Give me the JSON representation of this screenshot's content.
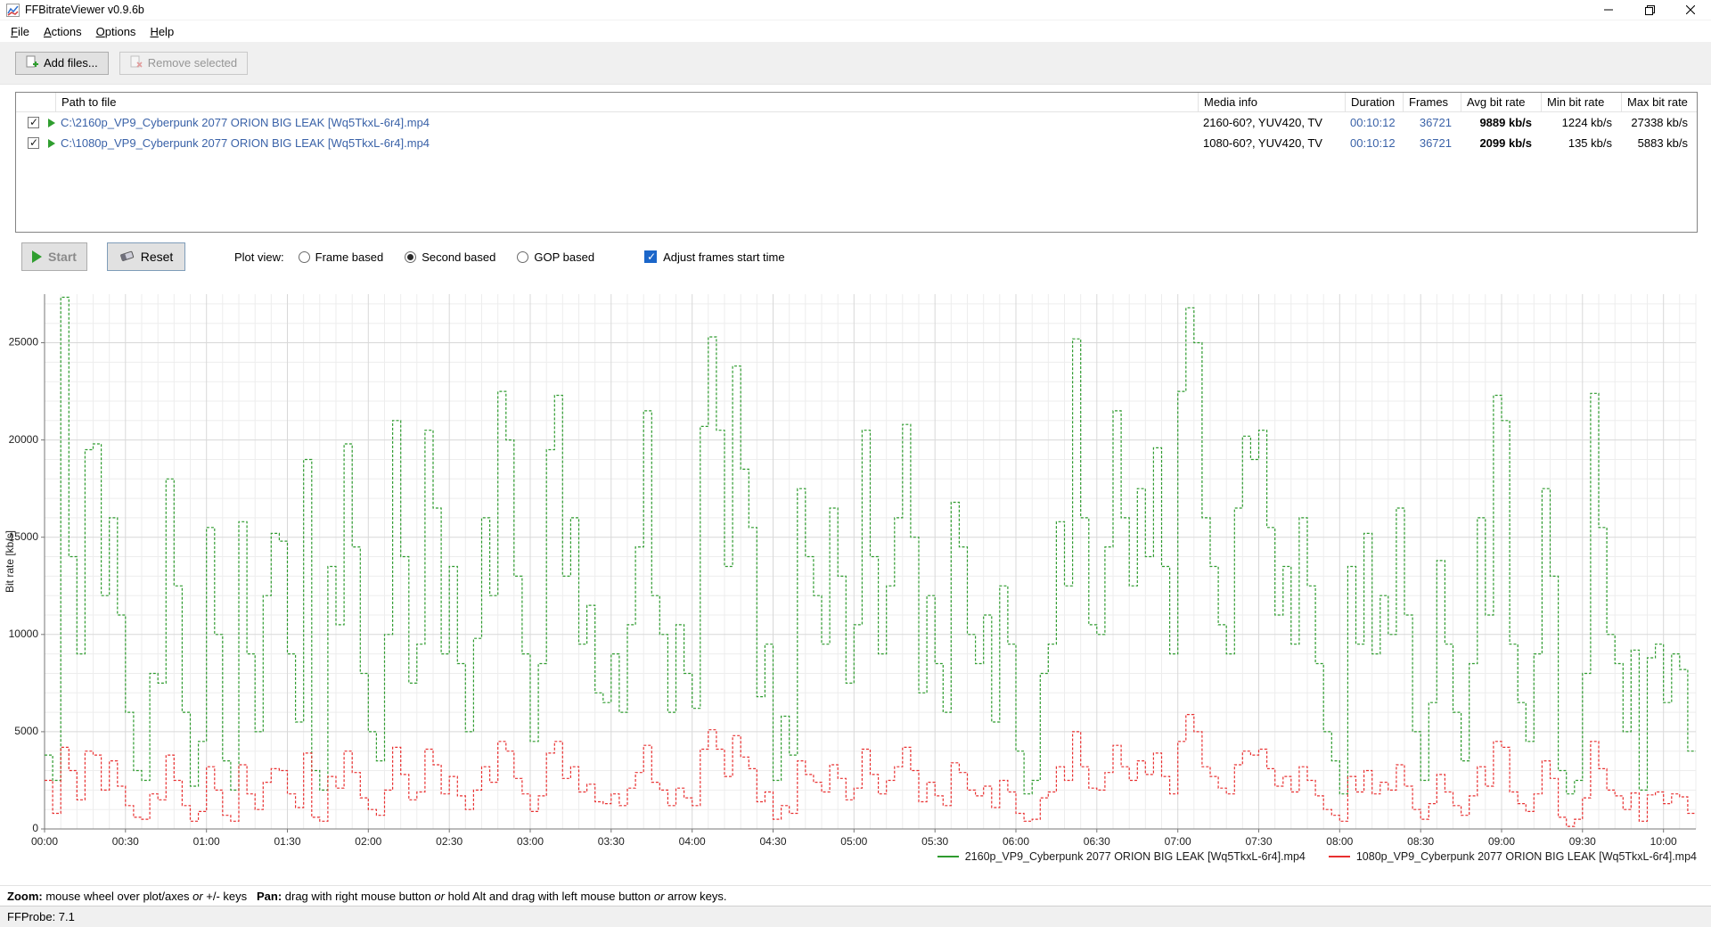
{
  "window": {
    "title": "FFBitrateViewer v0.9.6b"
  },
  "menu": {
    "items": [
      {
        "label": "File"
      },
      {
        "label": "Actions"
      },
      {
        "label": "Options"
      },
      {
        "label": "Help"
      }
    ]
  },
  "toolbar": {
    "add_files": "Add files...",
    "remove_selected": "Remove selected"
  },
  "table": {
    "headers": {
      "path": "Path to file",
      "media": "Media info",
      "duration": "Duration",
      "frames": "Frames",
      "avg": "Avg bit rate",
      "min": "Min bit rate",
      "max": "Max bit rate"
    },
    "rows": [
      {
        "checked": true,
        "path": "C:\\2160p_VP9_Cyberpunk 2077 ORION BIG LEAK [Wq5TkxL-6r4].mp4",
        "media": "2160-60?, YUV420, TV",
        "duration": "00:10:12",
        "frames": "36721",
        "avg": "9889 kb/s",
        "min": "1224 kb/s",
        "max": "27338 kb/s"
      },
      {
        "checked": true,
        "path": "C:\\1080p_VP9_Cyberpunk 2077 ORION BIG LEAK [Wq5TkxL-6r4].mp4",
        "media": "1080-60?, YUV420, TV",
        "duration": "00:10:12",
        "frames": "36721",
        "avg": "2099 kb/s",
        "min": "135 kb/s",
        "max": "5883 kb/s"
      }
    ]
  },
  "controls": {
    "start": "Start",
    "reset": "Reset",
    "plot_view_label": "Plot view:",
    "radios": [
      {
        "label": "Frame based",
        "selected": false
      },
      {
        "label": "Second based",
        "selected": true
      },
      {
        "label": "GOP based",
        "selected": false
      }
    ],
    "adjust_checkbox": {
      "label": "Adjust frames start time",
      "checked": true
    }
  },
  "chart_data": {
    "type": "line",
    "style": "dashed-step",
    "title": "",
    "xlabel": "",
    "ylabel": "Bit rate [kb/s]",
    "ylim": [
      0,
      27500
    ],
    "xlim_seconds": [
      0,
      612
    ],
    "x_step_seconds": 3,
    "yticks": [
      0,
      5000,
      10000,
      15000,
      20000,
      25000
    ],
    "xtick_interval_seconds": 30,
    "xtick_labels": [
      "00:00",
      "00:30",
      "01:00",
      "01:30",
      "02:00",
      "02:30",
      "03:00",
      "03:30",
      "04:00",
      "04:30",
      "05:00",
      "05:30",
      "06:00",
      "06:30",
      "07:00",
      "07:30",
      "08:00",
      "08:30",
      "09:00",
      "09:30",
      "10:00"
    ],
    "grid": true,
    "legend_position": "bottom-right",
    "series": [
      {
        "name": "2160p_VP9_Cyberpunk 2077 ORION BIG LEAK [Wq5TkxL-6r4].mp4",
        "color": "#2e9b2e",
        "avg_kbps": 9889,
        "min_kbps": 1224,
        "max_kbps": 27338,
        "values": [
          3800,
          2500,
          27338,
          14000,
          9000,
          19500,
          19800,
          12000,
          16000,
          11000,
          6000,
          3000,
          2500,
          8000,
          7500,
          18000,
          12500,
          6000,
          2200,
          4500,
          15500,
          10000,
          3500,
          2000,
          15800,
          9000,
          5000,
          12000,
          15200,
          14800,
          9000,
          5500,
          19000,
          3000,
          2000,
          13500,
          10500,
          19800,
          14500,
          8000,
          5000,
          3500,
          10000,
          21000,
          14000,
          7500,
          9500,
          20500,
          16500,
          9000,
          13500,
          8500,
          5000,
          9800,
          16000,
          12000,
          22500,
          20000,
          13000,
          9000,
          4500,
          8500,
          19500,
          22300,
          13000,
          16000,
          9500,
          11500,
          7000,
          6500,
          9000,
          6000,
          10500,
          14500,
          21500,
          12000,
          10000,
          6000,
          10500,
          8000,
          6200,
          20700,
          25300,
          20500,
          13500,
          23800,
          18500,
          15500,
          6800,
          9500,
          2500,
          5800,
          3800,
          17500,
          14000,
          12000,
          9500,
          16500,
          13000,
          7500,
          10500,
          20500,
          14000,
          9000,
          12500,
          16000,
          20800,
          15000,
          7000,
          12000,
          8500,
          6000,
          16800,
          14500,
          10000,
          8500,
          11000,
          5500,
          12500,
          9500,
          4000,
          1800,
          2500,
          8000,
          9500,
          15800,
          12500,
          25200,
          16000,
          10500,
          10000,
          14500,
          21500,
          16000,
          12500,
          17500,
          14000,
          19600,
          13500,
          9000,
          22500,
          26800,
          25000,
          16000,
          13500,
          10500,
          9000,
          16500,
          20200,
          19000,
          20500,
          15500,
          11000,
          13500,
          9500,
          16000,
          12500,
          8500,
          5000,
          3500,
          1800,
          13500,
          9500,
          15200,
          9000,
          12000,
          10000,
          16500,
          11000,
          5000,
          2500,
          6500,
          13800,
          9500,
          6000,
          3500,
          8500,
          16000,
          11000,
          22300,
          21000,
          9500,
          6500,
          4500,
          9000,
          17500,
          13000,
          3000,
          1800,
          2500,
          8000,
          22400,
          15500,
          10000,
          8500,
          5000,
          9200,
          2000,
          8800,
          9500,
          6500,
          9000,
          8200,
          4000
        ]
      },
      {
        "name": "1080p_VP9_Cyberpunk 2077 ORION BIG LEAK [Wq5TkxL-6r4].mp4",
        "color": "#e83030",
        "avg_kbps": 2099,
        "min_kbps": 135,
        "max_kbps": 5883,
        "values": [
          2500,
          800,
          4200,
          3000,
          1500,
          4000,
          3800,
          2000,
          3500,
          2200,
          1200,
          600,
          500,
          1800,
          1500,
          3800,
          2500,
          1200,
          400,
          900,
          3200,
          2000,
          700,
          400,
          3300,
          1800,
          1000,
          2400,
          3100,
          3000,
          1800,
          1100,
          3900,
          600,
          400,
          2700,
          2100,
          4000,
          2900,
          1600,
          1000,
          700,
          2000,
          4200,
          2800,
          1500,
          1900,
          4100,
          3300,
          1800,
          2700,
          1700,
          1000,
          2000,
          3200,
          2400,
          4500,
          4000,
          2600,
          1800,
          900,
          1700,
          3900,
          4500,
          2600,
          3200,
          1900,
          2300,
          1400,
          1300,
          1800,
          1200,
          2100,
          2900,
          4300,
          2400,
          2000,
          1200,
          2100,
          1600,
          1200,
          4100,
          5100,
          4100,
          2700,
          4800,
          3700,
          3100,
          1400,
          1900,
          500,
          1200,
          800,
          3500,
          2800,
          2400,
          1900,
          3300,
          2600,
          1500,
          2100,
          4100,
          2800,
          1800,
          2500,
          3200,
          4200,
          3000,
          1400,
          2400,
          1700,
          1200,
          3400,
          2900,
          2000,
          1700,
          2200,
          1100,
          2500,
          1900,
          800,
          400,
          500,
          1600,
          1900,
          3200,
          2500,
          5000,
          3200,
          2100,
          2000,
          2900,
          4300,
          3200,
          2500,
          3500,
          2800,
          3900,
          2700,
          1800,
          4500,
          5883,
          5000,
          3200,
          2700,
          2100,
          1800,
          3300,
          4000,
          3800,
          4100,
          3100,
          2200,
          2700,
          1900,
          3200,
          2500,
          1700,
          1000,
          700,
          400,
          2700,
          1900,
          3000,
          1800,
          2400,
          2000,
          3300,
          2200,
          1000,
          500,
          1300,
          2800,
          1900,
          1200,
          700,
          1700,
          3200,
          2200,
          4500,
          4200,
          1900,
          1300,
          900,
          1800,
          3500,
          2600,
          600,
          135,
          500,
          1600,
          4500,
          3100,
          2000,
          1700,
          1000,
          1850,
          400,
          1750,
          1900,
          1300,
          1800,
          1650,
          800
        ]
      }
    ]
  },
  "help": {
    "segments": [
      {
        "text": "Zoom:",
        "bold": true
      },
      {
        "text": " mouse wheel over plot/axes "
      },
      {
        "text": "or",
        "italic": true
      },
      {
        "text": " +/- keys   "
      },
      {
        "text": "Pan:",
        "bold": true
      },
      {
        "text": " drag with right mouse button "
      },
      {
        "text": "or",
        "italic": true
      },
      {
        "text": " hold Alt and drag with left mouse button "
      },
      {
        "text": "or",
        "italic": true
      },
      {
        "text": " arrow keys."
      }
    ]
  },
  "status": {
    "ffprobe": "FFProbe: 7.1"
  },
  "colors": {
    "series_green": "#2e9b2e",
    "series_red": "#e83030",
    "value_blue": "#3a62a8",
    "chrome_gray": "#f0f0f0"
  }
}
